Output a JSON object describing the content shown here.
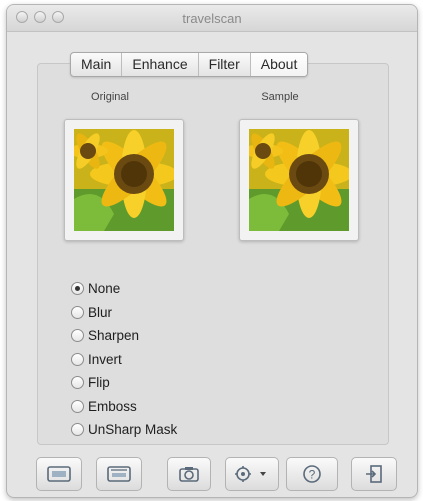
{
  "window": {
    "title": "travelscan"
  },
  "tabs": [
    {
      "label": "Main",
      "selected": false
    },
    {
      "label": "Enhance",
      "selected": false
    },
    {
      "label": "Filter",
      "selected": false
    },
    {
      "label": "About",
      "selected": true
    }
  ],
  "previews": {
    "original_label": "Original",
    "sample_label": "Sample"
  },
  "filters": {
    "options": [
      "None",
      "Blur",
      "Sharpen",
      "Invert",
      "Flip",
      "Emboss",
      "UnSharp Mask"
    ],
    "selected": "None"
  },
  "toolbar": {
    "buttons": [
      {
        "icon": "scan-icon"
      },
      {
        "icon": "scanner-icon"
      },
      {
        "icon": "camera-icon"
      },
      {
        "icon": "settings-dropdown-icon"
      },
      {
        "icon": "help-icon"
      },
      {
        "icon": "exit-icon"
      }
    ]
  },
  "colors": {
    "window_bg": "#e4e4e4",
    "petal": "#f2c21b",
    "sunflower_center": "#6b4a12",
    "leaf": "#4e8b2a"
  }
}
